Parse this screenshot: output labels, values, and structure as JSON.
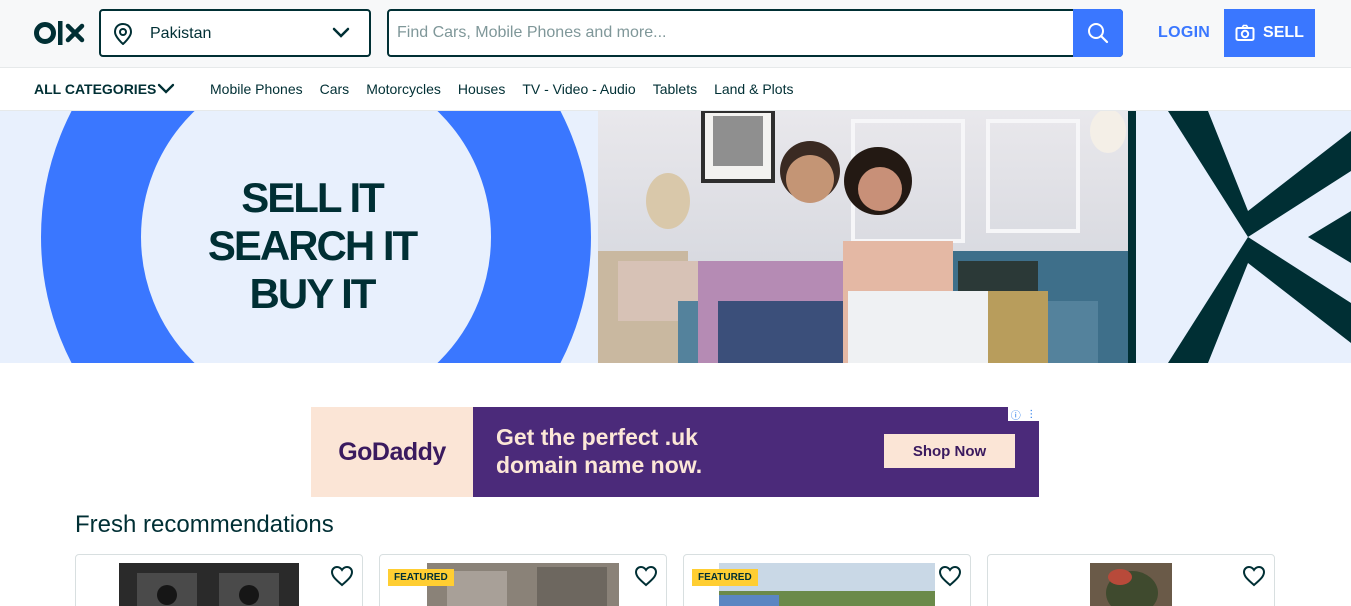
{
  "header": {
    "location": "Pakistan",
    "search_placeholder": "Find Cars, Mobile Phones and more...",
    "login_label": "LOGIN",
    "sell_label": "SELL"
  },
  "categories": {
    "all_label": "ALL CATEGORIES",
    "items": [
      "Mobile Phones",
      "Cars",
      "Motorcycles",
      "Houses",
      "TV - Video - Audio",
      "Tablets",
      "Land & Plots"
    ]
  },
  "hero": {
    "line1": "SELL IT",
    "line2": "SEARCH IT",
    "line3": "BUY IT"
  },
  "ad": {
    "brand": "GoDaddy",
    "headline_line1": "Get the perfect .uk",
    "headline_line2": "domain name now.",
    "cta": "Shop Now"
  },
  "recommendations": {
    "title": "Fresh recommendations",
    "cards": [
      {
        "featured": ""
      },
      {
        "featured": "FEATURED"
      },
      {
        "featured": "FEATURED"
      },
      {
        "featured": ""
      }
    ]
  },
  "colors": {
    "brand_dark": "#002f34",
    "accent_blue": "#3a77ff",
    "featured_yellow": "#ffce32",
    "hero_bg": "#e8f0fd"
  }
}
